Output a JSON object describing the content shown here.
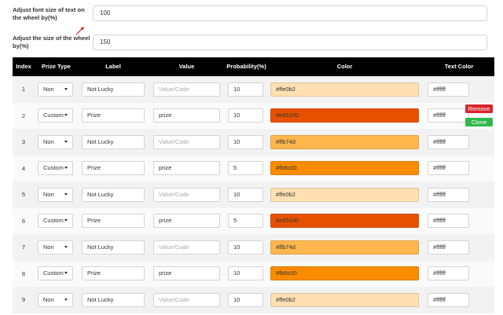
{
  "settings": {
    "font_size": {
      "label": "Adjust font size of text on the wheel by(%)",
      "value": "100"
    },
    "wheel_size": {
      "label": "Adjust the size of the wheel by(%)",
      "value": "150"
    }
  },
  "table": {
    "headers": {
      "index": "Index",
      "prize_type": "Prize Type",
      "label": "Label",
      "value": "Value",
      "probability": "Probability(%)",
      "color": "Color",
      "text_color": "Text Color"
    },
    "value_placeholder": "Value/Code",
    "rows": [
      {
        "index": "1",
        "prize_type": "Non",
        "label": "Not Lucky",
        "value": "",
        "probability": "10",
        "color": "#ffe0b2",
        "text_color": "#ffffff"
      },
      {
        "index": "2",
        "prize_type": "Custom",
        "label": "Prize",
        "value": "prize",
        "probability": "10",
        "color": "#e65100",
        "text_color": "#ffffff"
      },
      {
        "index": "3",
        "prize_type": "Non",
        "label": "Not Lucky",
        "value": "",
        "probability": "10",
        "color": "#ffb74d",
        "text_color": "#ffffff"
      },
      {
        "index": "4",
        "prize_type": "Custom",
        "label": "Prize",
        "value": "prize",
        "probability": "5",
        "color": "#fb8c00",
        "text_color": "#ffffff"
      },
      {
        "index": "5",
        "prize_type": "Non",
        "label": "Not Lucky",
        "value": "",
        "probability": "10",
        "color": "#ffe0b2",
        "text_color": "#ffffff"
      },
      {
        "index": "6",
        "prize_type": "Custom",
        "label": "Prize",
        "value": "prize",
        "probability": "5",
        "color": "#e65100",
        "text_color": "#ffffff"
      },
      {
        "index": "7",
        "prize_type": "Non",
        "label": "Not Lucky",
        "value": "",
        "probability": "10",
        "color": "#ffb74d",
        "text_color": "#ffffff"
      },
      {
        "index": "8",
        "prize_type": "Custom",
        "label": "Prize",
        "value": "prize",
        "probability": "10",
        "color": "#fb8c00",
        "text_color": "#ffffff"
      },
      {
        "index": "9",
        "prize_type": "Non",
        "label": "Not Lucky",
        "value": "",
        "probability": "10",
        "color": "#ffe0b2",
        "text_color": "#ffffff"
      }
    ]
  },
  "actions": {
    "remove_label": "Remove",
    "clone_label": "Clone"
  },
  "colors": {
    "header_bg": "#000000",
    "remove": "#d9262c",
    "clone": "#2eb84b",
    "arrow": "#e02020"
  },
  "icons": {
    "arrow": "red-arrow-icon",
    "caret": "chevron-down-icon"
  }
}
